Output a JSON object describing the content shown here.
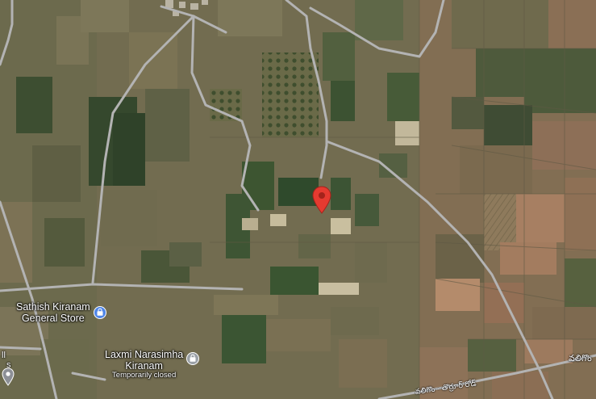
{
  "map": {
    "style": "satellite",
    "colors": {
      "terrain": "#6f6a4f",
      "road": "#b3b3b3",
      "pin": "#e53a30",
      "shopping_icon": "#4f86e8",
      "label_text": "#ffffff"
    }
  },
  "pois": [
    {
      "name_line1": "Sathish Kiranam",
      "name_line2": "General Store",
      "icon": "shopping-bag-icon"
    },
    {
      "name_line1": "Laxmi Narasimha",
      "name_line2": "Kiranam",
      "status": "Temporarily closed",
      "icon": "shopping-bag-icon"
    }
  ],
  "edge_labels": {
    "left_top": "ll",
    "left_mid": "s",
    "right": "వలిగొం"
  },
  "road_label": "వలిగొం - తొర్రూర్ రోడ్",
  "pin": {
    "icon": "location-pin-icon"
  }
}
